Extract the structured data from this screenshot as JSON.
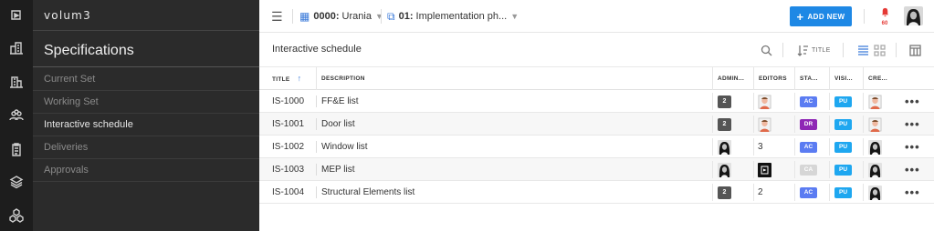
{
  "app": {
    "brand": "volum3"
  },
  "rail": {
    "icons": [
      "logo-icon",
      "buildings-icon",
      "building-icon",
      "team-icon",
      "clipboard-icon",
      "layers-icon",
      "cubes-icon"
    ]
  },
  "sidebar": {
    "section_title": "Specifications",
    "items": [
      {
        "label": "Current Set",
        "active": false
      },
      {
        "label": "Working Set",
        "active": false
      },
      {
        "label": "Interactive schedule",
        "active": true
      },
      {
        "label": "Deliveries",
        "active": false
      },
      {
        "label": "Approvals",
        "active": false
      }
    ]
  },
  "topbar": {
    "menu_icon": "hamburger-icon",
    "project_code": "0000:",
    "project_name": "Urania",
    "phase_code": "01:",
    "phase_name": "Implementation ph...",
    "add_new_label": "ADD NEW",
    "notifications_count": "60"
  },
  "toolbar": {
    "title": "Interactive schedule",
    "sort_label": "TITLE"
  },
  "table": {
    "columns": [
      "TITLE",
      "DESCRIPTION",
      "ADMIN...",
      "EDITORS",
      "STA...",
      "VISI...",
      "CRE..."
    ],
    "rows": [
      {
        "title": "IS-1000",
        "description": "FF&E list",
        "admin": {
          "type": "count",
          "value": "2"
        },
        "editors": {
          "type": "avatar",
          "value": "man"
        },
        "status": {
          "label": "AC",
          "color": "#5b7cf2"
        },
        "visibility": {
          "label": "PU",
          "color": "#1ea7f0"
        },
        "creator": "man"
      },
      {
        "title": "IS-1001",
        "description": "Door list",
        "admin": {
          "type": "count",
          "value": "2"
        },
        "editors": {
          "type": "avatar",
          "value": "man"
        },
        "status": {
          "label": "DR",
          "color": "#8e27b5"
        },
        "visibility": {
          "label": "PU",
          "color": "#1ea7f0"
        },
        "creator": "man"
      },
      {
        "title": "IS-1002",
        "description": "Window list",
        "admin": {
          "type": "avatar",
          "value": "woman"
        },
        "editors": {
          "type": "count_text",
          "value": "3"
        },
        "status": {
          "label": "AC",
          "color": "#5b7cf2"
        },
        "visibility": {
          "label": "PU",
          "color": "#1ea7f0"
        },
        "creator": "woman"
      },
      {
        "title": "IS-1003",
        "description": "MEP list",
        "admin": {
          "type": "avatar",
          "value": "woman"
        },
        "editors": {
          "type": "avatar",
          "value": "logo"
        },
        "status": {
          "label": "CA",
          "color": "#d6d6d6"
        },
        "visibility": {
          "label": "PU",
          "color": "#1ea7f0"
        },
        "creator": "woman"
      },
      {
        "title": "IS-1004",
        "description": "Structural Elements list",
        "admin": {
          "type": "count",
          "value": "2"
        },
        "editors": {
          "type": "count_text",
          "value": "2"
        },
        "status": {
          "label": "AC",
          "color": "#5b7cf2"
        },
        "visibility": {
          "label": "PU",
          "color": "#1ea7f0"
        },
        "creator": "woman"
      }
    ]
  },
  "colors": {
    "accent": "#1e88e5",
    "notification": "#e53935"
  }
}
